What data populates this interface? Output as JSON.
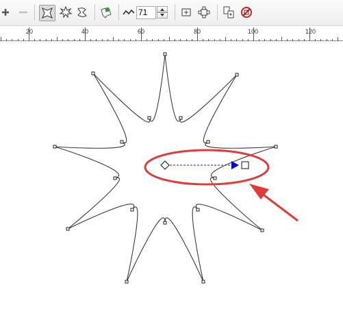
{
  "toolbar": {
    "items": [
      {
        "id": "add",
        "icon": "plus-icon"
      },
      {
        "id": "remove",
        "icon": "minus-icon"
      },
      {
        "id": "star-shape",
        "icon": "star-shape-icon",
        "pressed": true
      },
      {
        "id": "complex-star",
        "icon": "complex-star-icon"
      },
      {
        "id": "twist",
        "icon": "twist-icon"
      },
      {
        "id": "color-fill",
        "icon": "paint-splash-icon"
      },
      {
        "id": "sharpness",
        "icon": "wave-icon"
      },
      {
        "id": "center-node",
        "icon": "center-node-icon"
      },
      {
        "id": "transform",
        "icon": "transform-icon"
      },
      {
        "id": "copy-properties",
        "icon": "copy-properties-icon"
      },
      {
        "id": "clear-effect",
        "icon": "clear-effect-icon"
      }
    ],
    "sharpness_value": "71"
  },
  "ruler": {
    "labels": [
      "20",
      "40",
      "60",
      "80",
      "100",
      "120"
    ]
  },
  "colors": {
    "annotation": "#e03a3a",
    "handle_line": "#1a1aa6",
    "handle_arrow": "#0000e6"
  }
}
